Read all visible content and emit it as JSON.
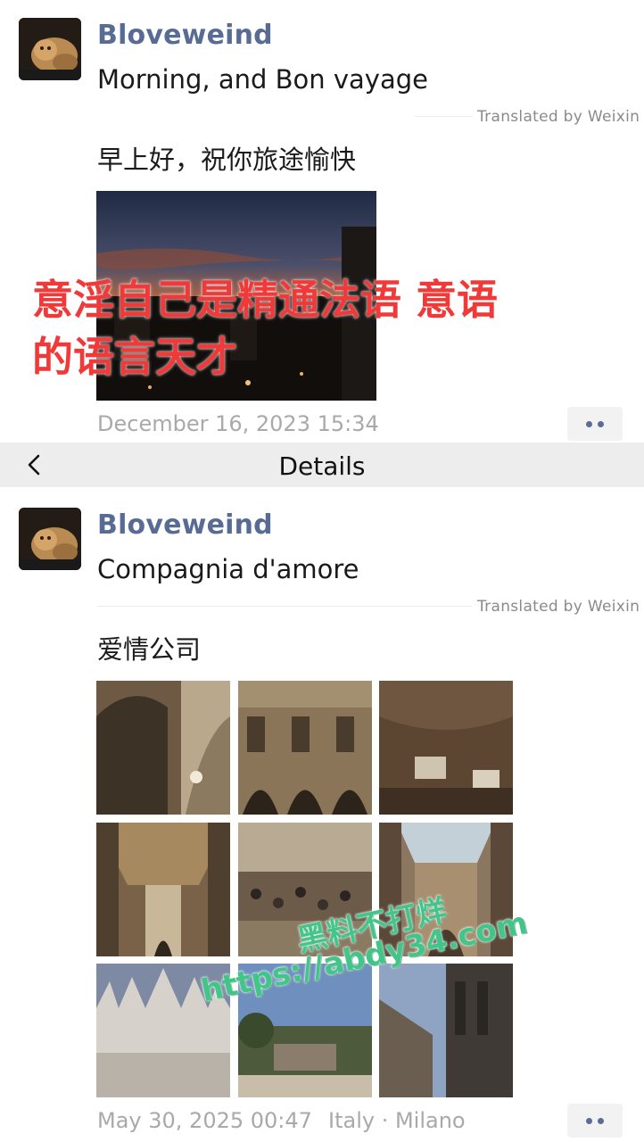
{
  "post1": {
    "username": "Bloveweind",
    "text": "Morning, and Bon vayage",
    "translated_by": "Translated by Weixin",
    "translation": "早上好，祝你旅途愉快",
    "overlay_line1": "意淫自己是精通法语 意语",
    "overlay_line2": "的语言天才",
    "timestamp": "December 16, 2023 15:34"
  },
  "navbar": {
    "title": "Details"
  },
  "post2": {
    "username": "Bloveweind",
    "text": "Compagnia d'amore",
    "translated_by": "Translated by Weixin",
    "translation": "爱情公司",
    "timestamp": "May 30, 2025 00:47",
    "location": "Italy · Milano"
  },
  "watermark": {
    "line1": "黑料不打烊",
    "line2": "https://abdy34.com"
  },
  "colors": {
    "username": "#576b95",
    "overlay_red": "#f03a3a",
    "watermark_green": "#43c58a"
  }
}
